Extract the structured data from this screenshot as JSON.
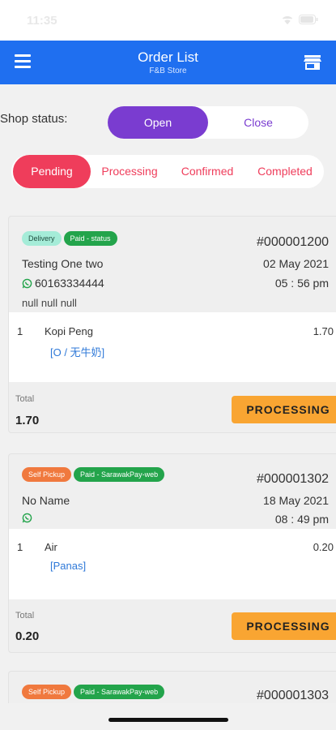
{
  "status_bar": {
    "time": "11:35"
  },
  "header": {
    "title": "Order List",
    "subtitle": "F&B Store"
  },
  "shop_status": {
    "label": "Shop status:",
    "open_label": "Open",
    "close_label": "Close",
    "selected": "Open"
  },
  "tabs": [
    {
      "label": "Pending",
      "active": true
    },
    {
      "label": "Processing",
      "active": false
    },
    {
      "label": "Confirmed",
      "active": false
    },
    {
      "label": "Completed",
      "active": false
    }
  ],
  "orders": [
    {
      "badges": [
        "Delivery",
        "Paid - status"
      ],
      "order_no": "#000001200",
      "customer": "Testing One two",
      "date": "02 May 2021",
      "phone": "60163334444",
      "time": "05 : 56 pm",
      "address": "null null null",
      "items": [
        {
          "qty": "1",
          "name": "Kopi Peng",
          "price": "1.70",
          "modifier": "[O / 无牛奶]"
        }
      ],
      "total_label": "Total",
      "total": "1.70",
      "action": "PROCESSING"
    },
    {
      "badges": [
        "Self Pickup",
        "Paid - SarawakPay-web"
      ],
      "order_no": "#000001302",
      "customer": "No Name",
      "date": "18 May 2021",
      "phone": "",
      "time": "08 : 49 pm",
      "items": [
        {
          "qty": "1",
          "name": "Air",
          "price": "0.20",
          "modifier": "[Panas]"
        }
      ],
      "total_label": "Total",
      "total": "0.20",
      "action": "PROCESSING"
    },
    {
      "badges": [
        "Self Pickup",
        "Paid - SarawakPay-web"
      ],
      "order_no": "#000001303"
    }
  ],
  "colors": {
    "primary": "#1f6ff0",
    "open": "#7a3cd0",
    "tab_active": "#ef3d5b",
    "action": "#f9a532",
    "paid": "#23a44b",
    "self_pickup": "#f0793e",
    "delivery": "#a5ecd8"
  },
  "icons": {
    "menu": "hamburger-menu-icon",
    "store": "store-icon",
    "whatsapp": "whatsapp-icon"
  }
}
